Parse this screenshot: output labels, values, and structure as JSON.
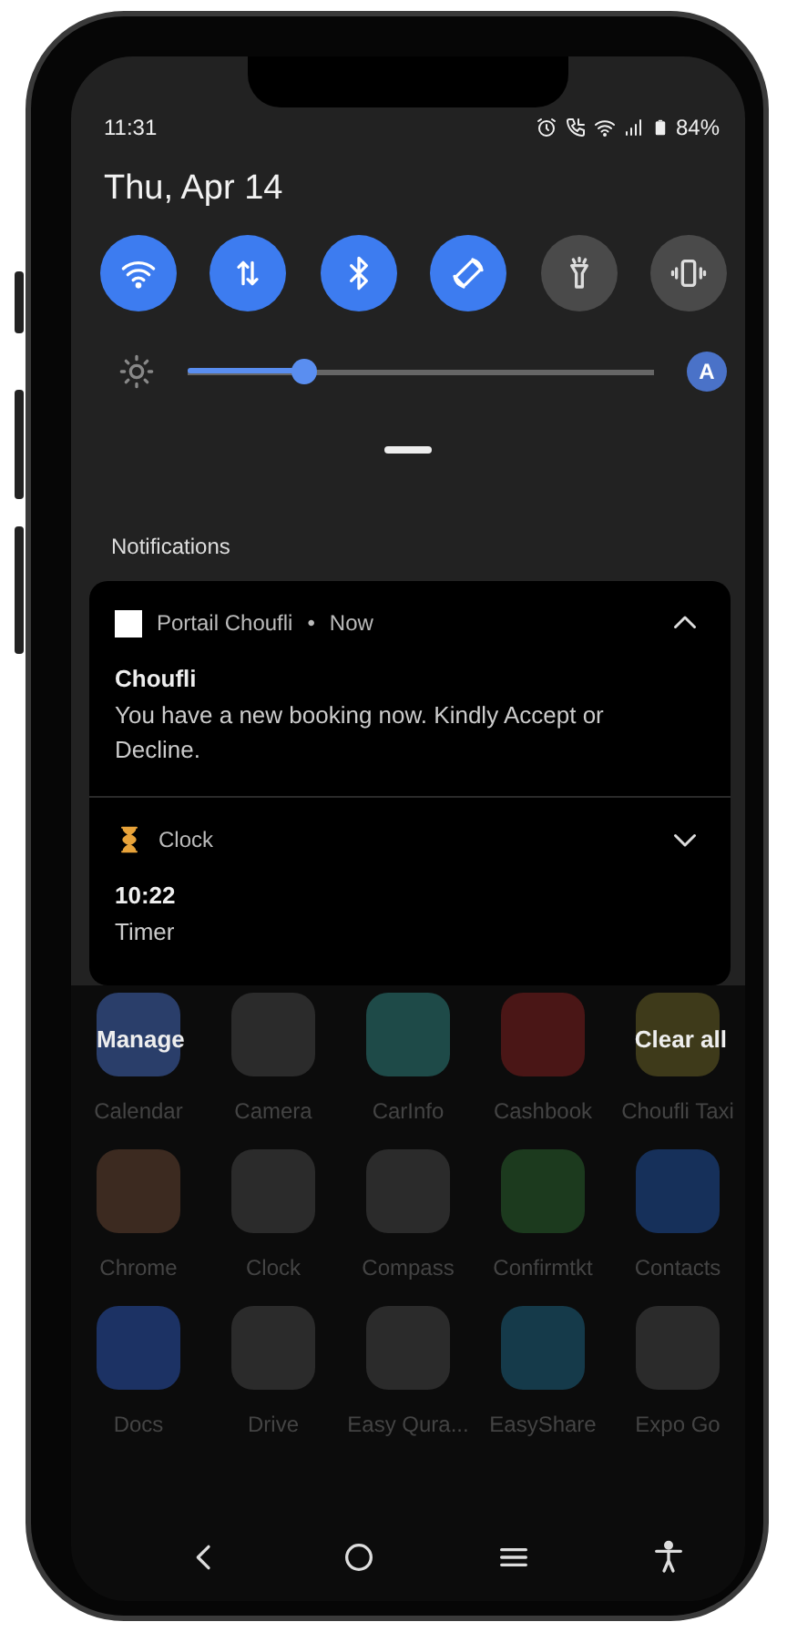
{
  "status_bar": {
    "time": "11:31",
    "battery": "84%"
  },
  "date": "Thu, Apr 14",
  "quick_tiles": [
    {
      "kind": "wifi",
      "on": true
    },
    {
      "kind": "data",
      "on": true
    },
    {
      "kind": "bluetooth",
      "on": true
    },
    {
      "kind": "rotate",
      "on": true
    },
    {
      "kind": "flashlight",
      "on": false
    },
    {
      "kind": "vibrate",
      "on": false
    }
  ],
  "brightness": {
    "level": 0.25,
    "auto_label": "A",
    "auto": true
  },
  "notifications_header": "Notifications",
  "notifications": [
    {
      "kind": "app",
      "app": "Portail Choufli",
      "separator": "•",
      "time": "Now",
      "title": "Choufli",
      "text": "You have a new booking now. Kindly Accept or Decline.",
      "expanded": true
    },
    {
      "kind": "timer",
      "app": "Clock",
      "title": "10:22",
      "text": "Timer",
      "expanded": false
    }
  ],
  "actions": {
    "manage": "Manage",
    "clear_all": "Clear all"
  },
  "apps": [
    {
      "label": "Calendar",
      "color": "#2a3e6a"
    },
    {
      "label": "Camera",
      "color": "#2b2b2b"
    },
    {
      "label": "CarInfo",
      "color": "#1e4a48"
    },
    {
      "label": "Cashbook",
      "color": "#4a1616"
    },
    {
      "label": "Choufli Taxi",
      "color": "#3e3a1a"
    },
    {
      "label": "Chrome",
      "color": "#3c2a20"
    },
    {
      "label": "Clock",
      "color": "#2b2b2b"
    },
    {
      "label": "Compass",
      "color": "#2b2b2b"
    },
    {
      "label": "Confirmtkt",
      "color": "#1c3a1e"
    },
    {
      "label": "Contacts",
      "color": "#16305a"
    },
    {
      "label": "Docs",
      "color": "#1c3264"
    },
    {
      "label": "Drive",
      "color": "#2b2b2b"
    },
    {
      "label": "Easy Qura...",
      "color": "#2b2b2b"
    },
    {
      "label": "EasyShare",
      "color": "#153a4a"
    },
    {
      "label": "Expo Go",
      "color": "#2b2b2b"
    }
  ]
}
